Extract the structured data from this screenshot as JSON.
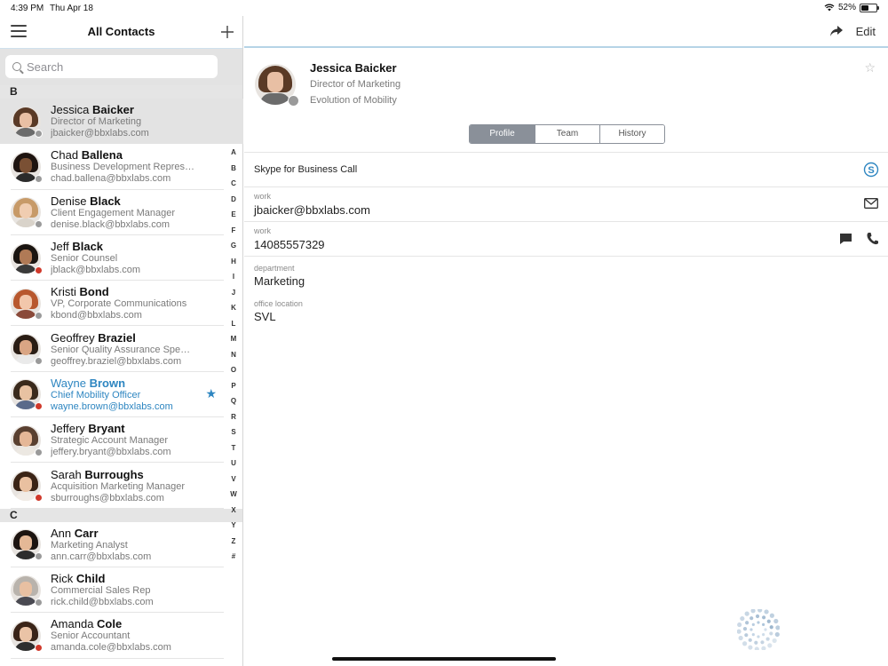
{
  "status": {
    "time": "4:39 PM",
    "date": "Thu Apr 18",
    "battery": "52%",
    "battery_level": 0.52
  },
  "left": {
    "title": "All Contacts",
    "search_placeholder": "Search",
    "index_letters": [
      "A",
      "B",
      "C",
      "D",
      "E",
      "F",
      "G",
      "H",
      "I",
      "J",
      "K",
      "L",
      "M",
      "N",
      "O",
      "P",
      "Q",
      "R",
      "S",
      "T",
      "U",
      "V",
      "W",
      "X",
      "Y",
      "Z",
      "#"
    ],
    "sections": [
      {
        "letter": "B",
        "contacts": [
          {
            "first": "Jessica",
            "last": "Baicker",
            "title": "Director of Marketing",
            "email": "jbaicker@bbxlabs.com",
            "status": "gray",
            "selected": true,
            "hair": "#5a3a26",
            "skin": "#e8bfa4",
            "body": "#6b6b6b"
          },
          {
            "first": "Chad",
            "last": "Ballena",
            "title": "Business Development Repres…",
            "email": "chad.ballena@bbxlabs.com",
            "status": "gray",
            "hair": "#1e1410",
            "skin": "#7a5034",
            "body": "#2b2b2b"
          },
          {
            "first": "Denise",
            "last": "Black",
            "title": "Client Engagement Manager",
            "email": "denise.black@bbxlabs.com",
            "status": "gray",
            "hair": "#c79a68",
            "skin": "#f0cdb1",
            "body": "#d9d3ca"
          },
          {
            "first": "Jeff",
            "last": "Black",
            "title": "Senior Counsel",
            "email": "jblack@bbxlabs.com",
            "status": "red",
            "hair": "#1a1410",
            "skin": "#b07a56",
            "body": "#3a3a3a"
          },
          {
            "first": "Kristi",
            "last": "Bond",
            "title": "VP, Corporate Communications",
            "email": "kbond@bbxlabs.com",
            "status": "gray",
            "hair": "#b8582e",
            "skin": "#f2c7ab",
            "body": "#8a4a3a"
          },
          {
            "first": "Geoffrey",
            "last": "Braziel",
            "title": "Senior Quality Assurance Spe…",
            "email": "geoffrey.braziel@bbxlabs.com",
            "status": "gray",
            "hair": "#2a1d14",
            "skin": "#d9a584",
            "body": "#eaeaea"
          },
          {
            "first": "Wayne",
            "last": "Brown",
            "title": "Chief Mobility Officer",
            "email": "wayne.brown@bbxlabs.com",
            "status": "red",
            "favorite": true,
            "hair": "#3a2a1c",
            "skin": "#e8c2a2",
            "body": "#5a6a8a"
          },
          {
            "first": "Jeffery",
            "last": "Bryant",
            "title": "Strategic Account Manager",
            "email": "jeffery.bryant@bbxlabs.com",
            "status": "gray",
            "hair": "#5a4030",
            "skin": "#e5b797",
            "body": "#ece8e2"
          },
          {
            "first": "Sarah",
            "last": "Burroughs",
            "title": "Acquisition Marketing Manager",
            "email": "sburroughs@bbxlabs.com",
            "status": "red",
            "hair": "#3b2416",
            "skin": "#e9c0a0",
            "body": "#f1ece6"
          }
        ]
      },
      {
        "letter": "C",
        "contacts": [
          {
            "first": "Ann",
            "last": "Carr",
            "title": "Marketing Analyst",
            "email": "ann.carr@bbxlabs.com",
            "status": "gray",
            "hair": "#1c1410",
            "skin": "#e4b896",
            "body": "#2c2c2c"
          },
          {
            "first": "Rick",
            "last": "Child",
            "title": "Commercial Sales Rep",
            "email": "rick.child@bbxlabs.com",
            "status": "gray",
            "hair": "#b9b3ac",
            "skin": "#e8c0a2",
            "body": "#4a4a52"
          },
          {
            "first": "Amanda",
            "last": "Cole",
            "title": "Senior Accountant",
            "email": "amanda.cole@bbxlabs.com",
            "status": "red",
            "hair": "#3a2418",
            "skin": "#eac3a6",
            "body": "#2e2e2e"
          }
        ]
      }
    ]
  },
  "right": {
    "edit_label": "Edit",
    "name": "Jessica Baicker",
    "title": "Director of Marketing",
    "company": "Evolution of Mobility",
    "tabs": [
      {
        "label": "Profile",
        "active": true
      },
      {
        "label": "Team",
        "active": false
      },
      {
        "label": "History",
        "active": false
      }
    ],
    "skype_call": "Skype for Business Call",
    "fields": [
      {
        "label": "work",
        "value": "jbaicker@bbxlabs.com",
        "kind": "email"
      },
      {
        "label": "work",
        "value": "14085557329",
        "kind": "phone"
      },
      {
        "label": "department",
        "value": "Marketing",
        "kind": "plain"
      },
      {
        "label": "office location",
        "value": "SVL",
        "kind": "plain"
      }
    ]
  },
  "colors": {
    "accent": "#2e86c1",
    "presence_gray": "#9a9a9a",
    "presence_red": "#d0392b",
    "segment": "#8a9099"
  },
  "icons": {
    "menu": "menu-icon",
    "add": "plus-icon",
    "search": "search-icon",
    "share": "share-icon",
    "star": "star-icon",
    "skype": "skype-icon",
    "mail": "mail-icon",
    "chat": "chat-icon",
    "phone": "phone-icon"
  }
}
